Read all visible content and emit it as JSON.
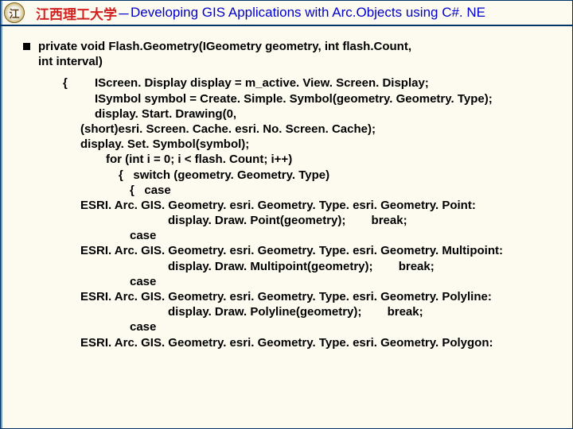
{
  "header": {
    "logo_letter": "江",
    "org": "江西理工大学",
    "sep": "－",
    "title": "Developing GIS Applications with Arc.Objects using C#. NE"
  },
  "signature": {
    "line1": "private void Flash.Geometry(IGeometry geometry, int flash.Count,",
    "line2": "int interval)"
  },
  "code": {
    "brace": "{",
    "l1": "IScreen. Display display = m_active. View. Screen. Display;",
    "l2": "ISymbol symbol = Create. Simple. Symbol(geometry. Geometry. Type);",
    "l3": "display. Start. Drawing(0,",
    "l4": "(short)esri. Screen. Cache. esri. No. Screen. Cache);",
    "l5": "display. Set. Symbol(symbol);",
    "l6": "for (int i = 0; i < flash. Count; i++)",
    "l7a": "{",
    "l7b": "switch (geometry. Geometry. Type)",
    "l8a": "{",
    "l8b": "case",
    "l9": "ESRI. Arc. GIS. Geometry. esri. Geometry. Type. esri. Geometry. Point:",
    "l10a": "display. Draw. Point(geometry);",
    "l10b": "break;",
    "l11": "case",
    "l12": "ESRI. Arc. GIS. Geometry. esri. Geometry. Type. esri. Geometry. Multipoint:",
    "l13a": "display. Draw. Multipoint(geometry);",
    "l13b": "break;",
    "l14": "case",
    "l15": "ESRI. Arc. GIS. Geometry. esri. Geometry. Type. esri. Geometry. Polyline:",
    "l16a": "display. Draw. Polyline(geometry);",
    "l16b": "break;",
    "l17": "case",
    "l18": "ESRI. Arc. GIS. Geometry. esri. Geometry. Type. esri. Geometry. Polygon:"
  }
}
